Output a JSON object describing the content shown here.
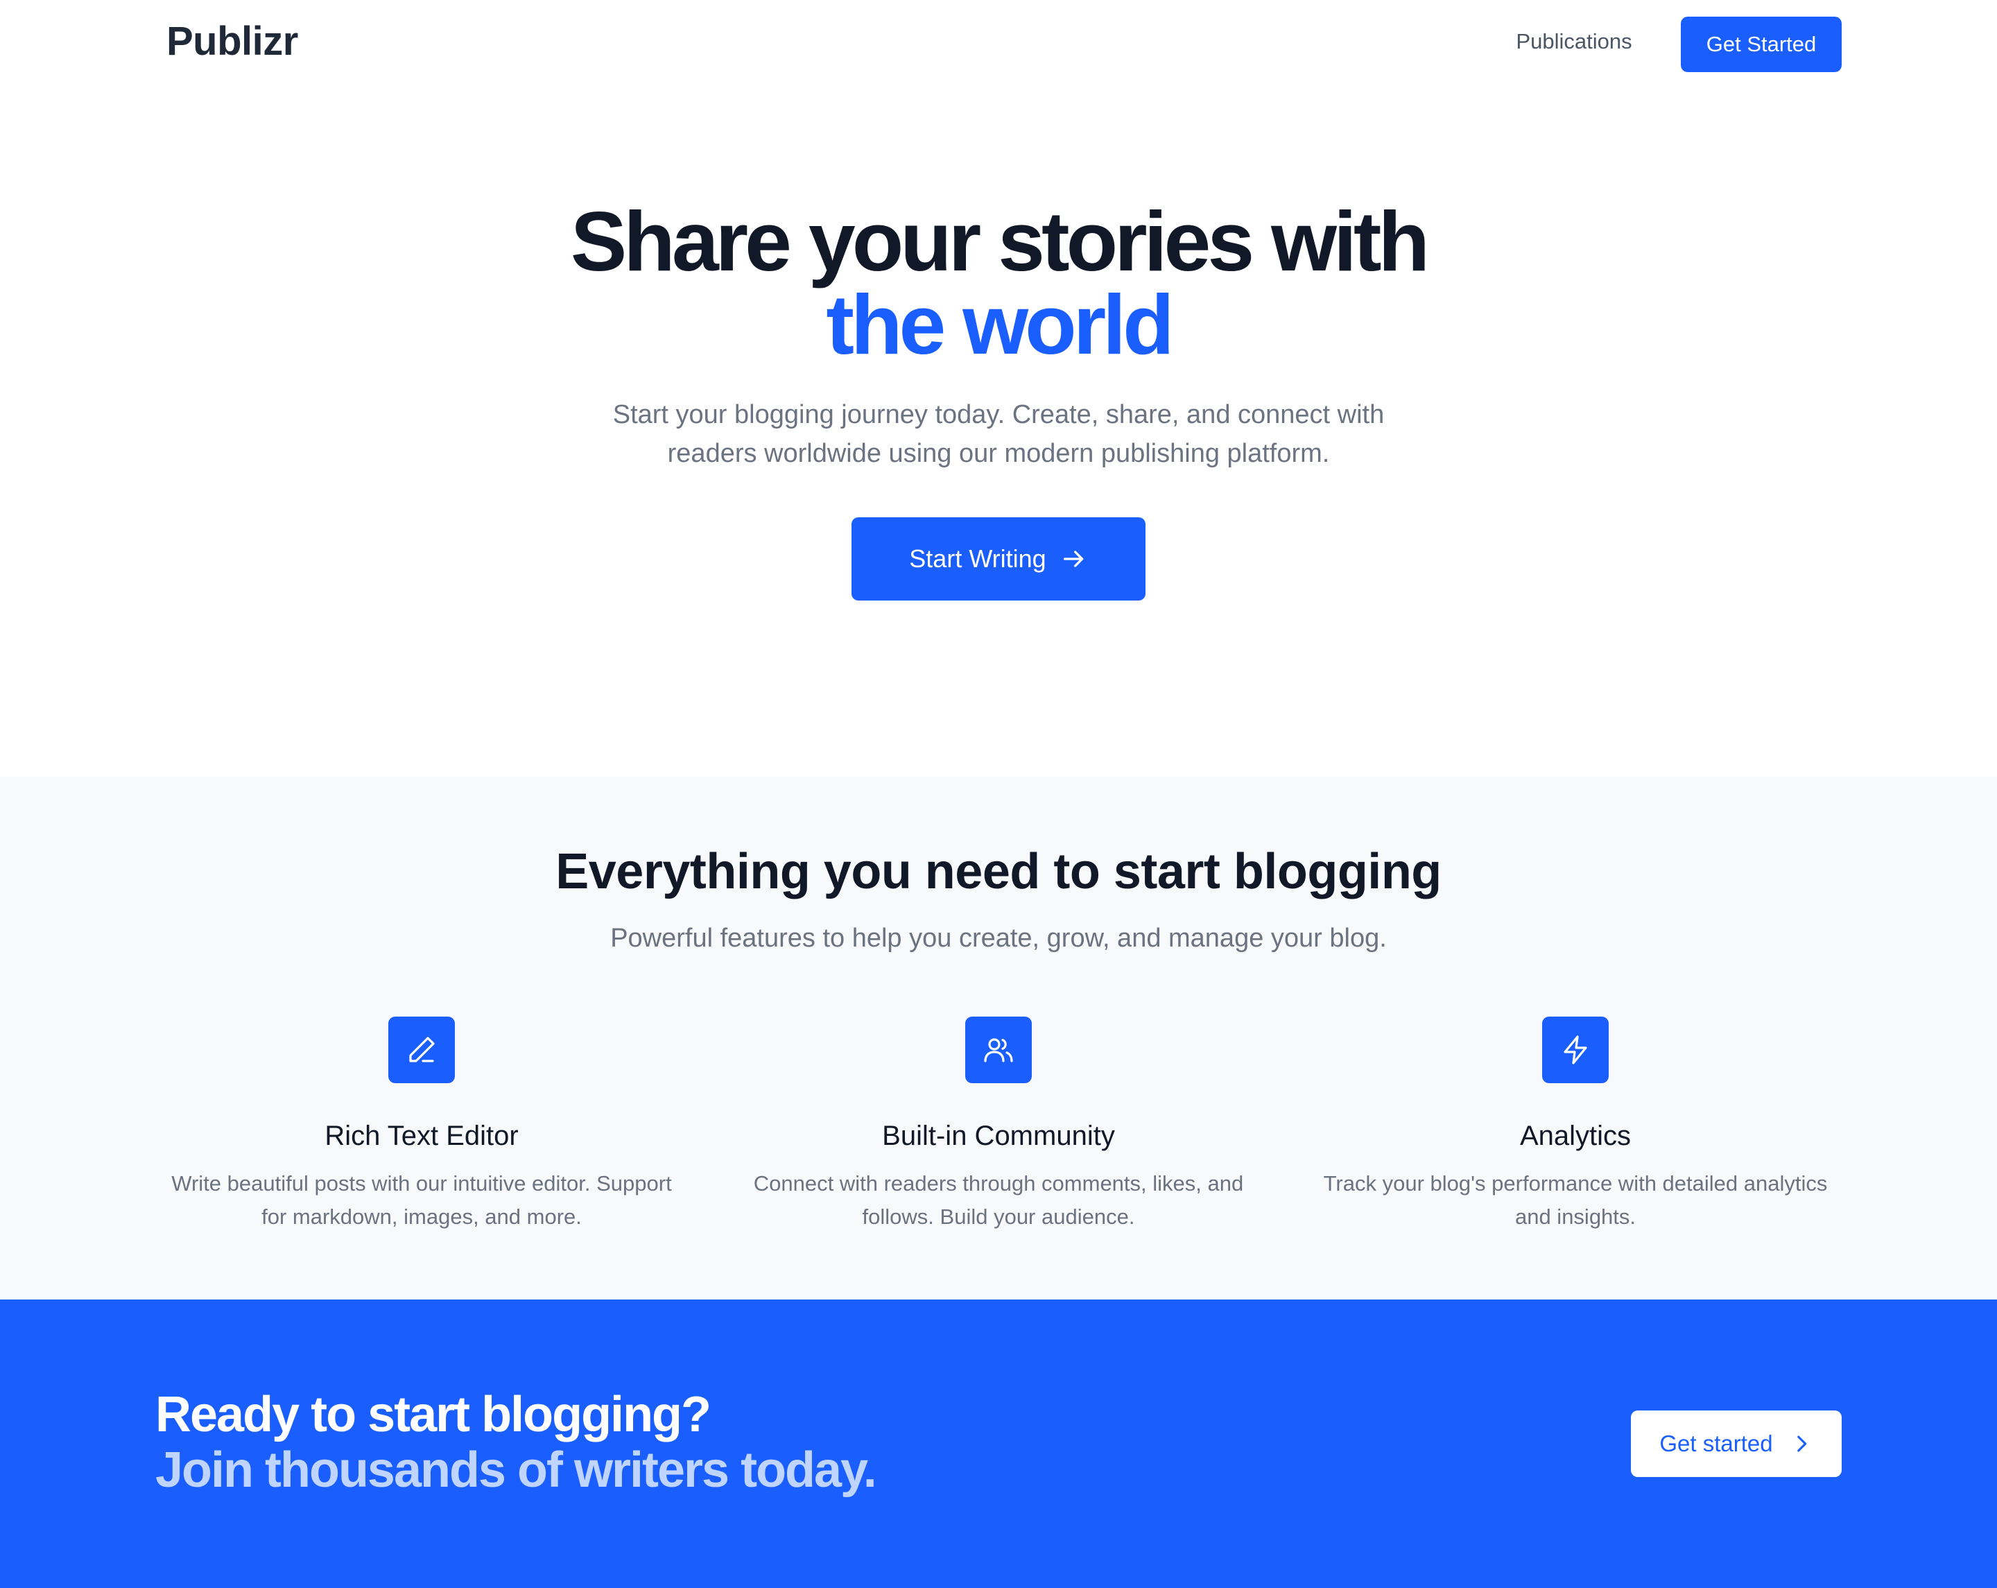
{
  "nav": {
    "logo": "Publizr",
    "link_publications": "Publications",
    "cta_label": "Get Started"
  },
  "hero": {
    "title_line1": "Share your stories with",
    "title_accent": "the world",
    "subtitle": "Start your blogging journey today. Create, share, and connect with readers worldwide using our modern publishing platform.",
    "cta_label": "Start Writing",
    "cta_icon": "arrow-right-icon"
  },
  "features": {
    "title": "Everything you need to start blogging",
    "subtitle": "Powerful features to help you create, grow, and manage your blog.",
    "items": [
      {
        "icon": "pencil-icon",
        "name": "Rich Text Editor",
        "description": "Write beautiful posts with our intuitive editor. Support for markdown, images, and more."
      },
      {
        "icon": "users-icon",
        "name": "Built-in Community",
        "description": "Connect with readers through comments, likes, and follows. Build your audience."
      },
      {
        "icon": "lightning-icon",
        "name": "Analytics",
        "description": "Track your blog's performance with detailed analytics and insights."
      }
    ]
  },
  "cta": {
    "line1": "Ready to start blogging?",
    "line2": "Join thousands of writers today.",
    "button_label": "Get started",
    "button_icon": "chevron-right-icon"
  },
  "colors": {
    "accent": "#1a5ffd",
    "accent_light": "#bfd4ff",
    "heading": "#111827",
    "muted": "#6b7280",
    "section_bg": "#f8f9fb"
  }
}
